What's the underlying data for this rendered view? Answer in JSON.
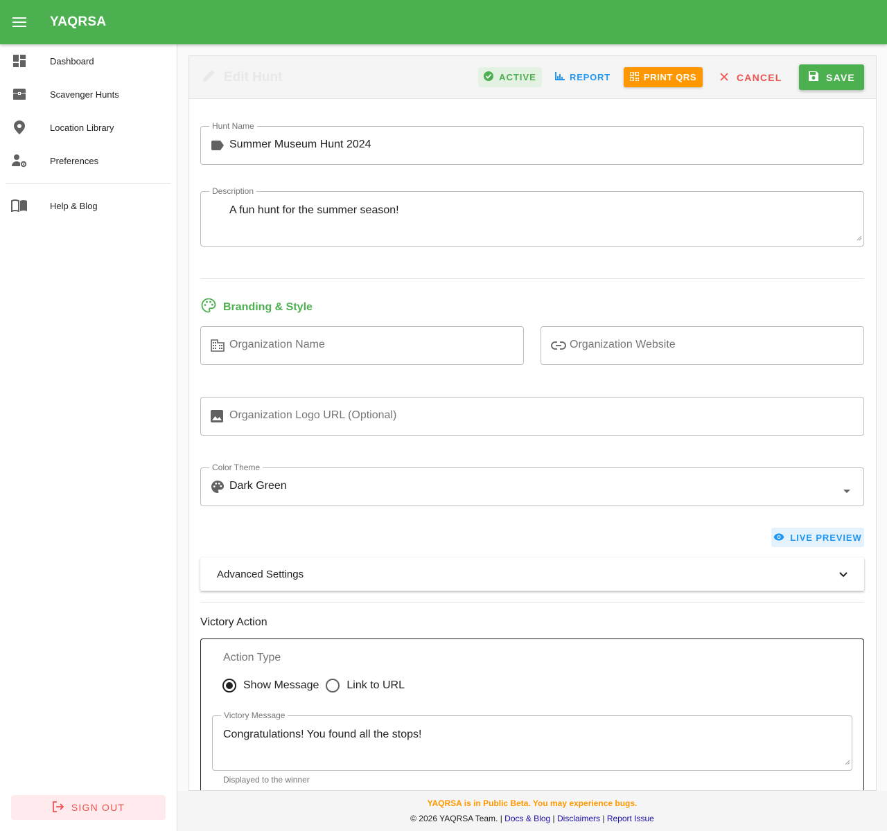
{
  "app": {
    "title": "YAQRSA"
  },
  "sidebar": {
    "items": [
      {
        "label": "Dashboard",
        "icon": "dashboard-icon"
      },
      {
        "label": "Scavenger Hunts",
        "icon": "treasure-chest-icon"
      },
      {
        "label": "Location Library",
        "icon": "location-pin-icon"
      },
      {
        "label": "Preferences",
        "icon": "user-settings-icon"
      }
    ],
    "help": {
      "label": "Help & Blog",
      "icon": "book-icon"
    },
    "signout_label": "SIGN OUT"
  },
  "header": {
    "title": "Edit Hunt",
    "status_label": "ACTIVE",
    "report_label": "REPORT",
    "print_label": "PRINT QRS",
    "cancel_label": "CANCEL",
    "save_label": "SAVE"
  },
  "form": {
    "hunt_name": {
      "label": "Hunt Name",
      "value": "Summer Museum Hunt 2024"
    },
    "description": {
      "label": "Description",
      "value": "A fun hunt for the summer season!"
    },
    "branding": {
      "title": "Branding & Style",
      "org_name_placeholder": "Organization Name",
      "org_website_placeholder": "Organization Website",
      "org_logo_placeholder": "Organization Logo URL (Optional)",
      "color_theme": {
        "label": "Color Theme",
        "value": "Dark Green"
      },
      "live_preview_label": "LIVE PREVIEW"
    },
    "advanced_label": "Advanced Settings",
    "victory": {
      "title": "Victory Action",
      "action_type_label": "Action Type",
      "options": [
        "Show Message",
        "Link to URL"
      ],
      "selected": "Show Message",
      "message_label": "Victory Message",
      "message_value": "Congratulations! You found all the stops!",
      "hint": "Displayed to the winner"
    }
  },
  "footer": {
    "beta": "YAQRSA is in Public Beta. You may experience bugs.",
    "copyright": "© 2026 YAQRSA Team.",
    "links": [
      "Docs & Blog",
      "Disclaimers",
      "Report Issue"
    ]
  },
  "colors": {
    "primary": "#4caf50",
    "warning": "#ff9800",
    "info": "#2196f3",
    "danger": "#ef5350"
  }
}
